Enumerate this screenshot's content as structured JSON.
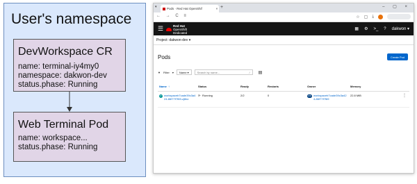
{
  "diagram": {
    "namespace_title": "User's namespace",
    "cr": {
      "title": "DevWorkspace CR",
      "lines": [
        "name: terminal-iy4my0",
        "namespace: dakwon-dev",
        "status.phase: Running"
      ]
    },
    "pod": {
      "title": "Web Terminal Pod",
      "lines": [
        "name: workspace...",
        "status.phase: Running"
      ]
    }
  },
  "browser": {
    "tab_title": "Pods · Red Hat OpenShif",
    "tab_close": "×",
    "new_tab": "+",
    "nav": "← → C ≡",
    "masthead": {
      "logo_line1": "Red Hat",
      "logo_line2": "OpenShift",
      "logo_line3": "Dedicated",
      "user": "dakwon ▾"
    },
    "project_label": "Project: dakwon-dev ▾",
    "page_title": "Pods",
    "create_button": "Create Pod",
    "toolbar": {
      "filter": "Filter",
      "name_select": "Name",
      "search_placeholder": "Search by name...",
      "search_slash": "/"
    },
    "table": {
      "headers": [
        "Name",
        "Status",
        "Ready",
        "Restarts",
        "Owner",
        "Memory"
      ],
      "row": {
        "name_badge": "P",
        "name": "workspaceb7cade39c3a424-86f77f7f69-zj6bz",
        "status": "Running",
        "ready": "2/2",
        "restarts": "0",
        "owner_badge": "RS",
        "owner": "workspaceb7cade39c3a424-86f77f7f69",
        "memory": "22.8 MiB"
      }
    }
  },
  "colors": {
    "namespace_fill": "#dae8fc",
    "namespace_border": "#6c8ebf",
    "box_fill": "#e1d5e7",
    "masthead": "#151515",
    "link": "#0066cc"
  }
}
